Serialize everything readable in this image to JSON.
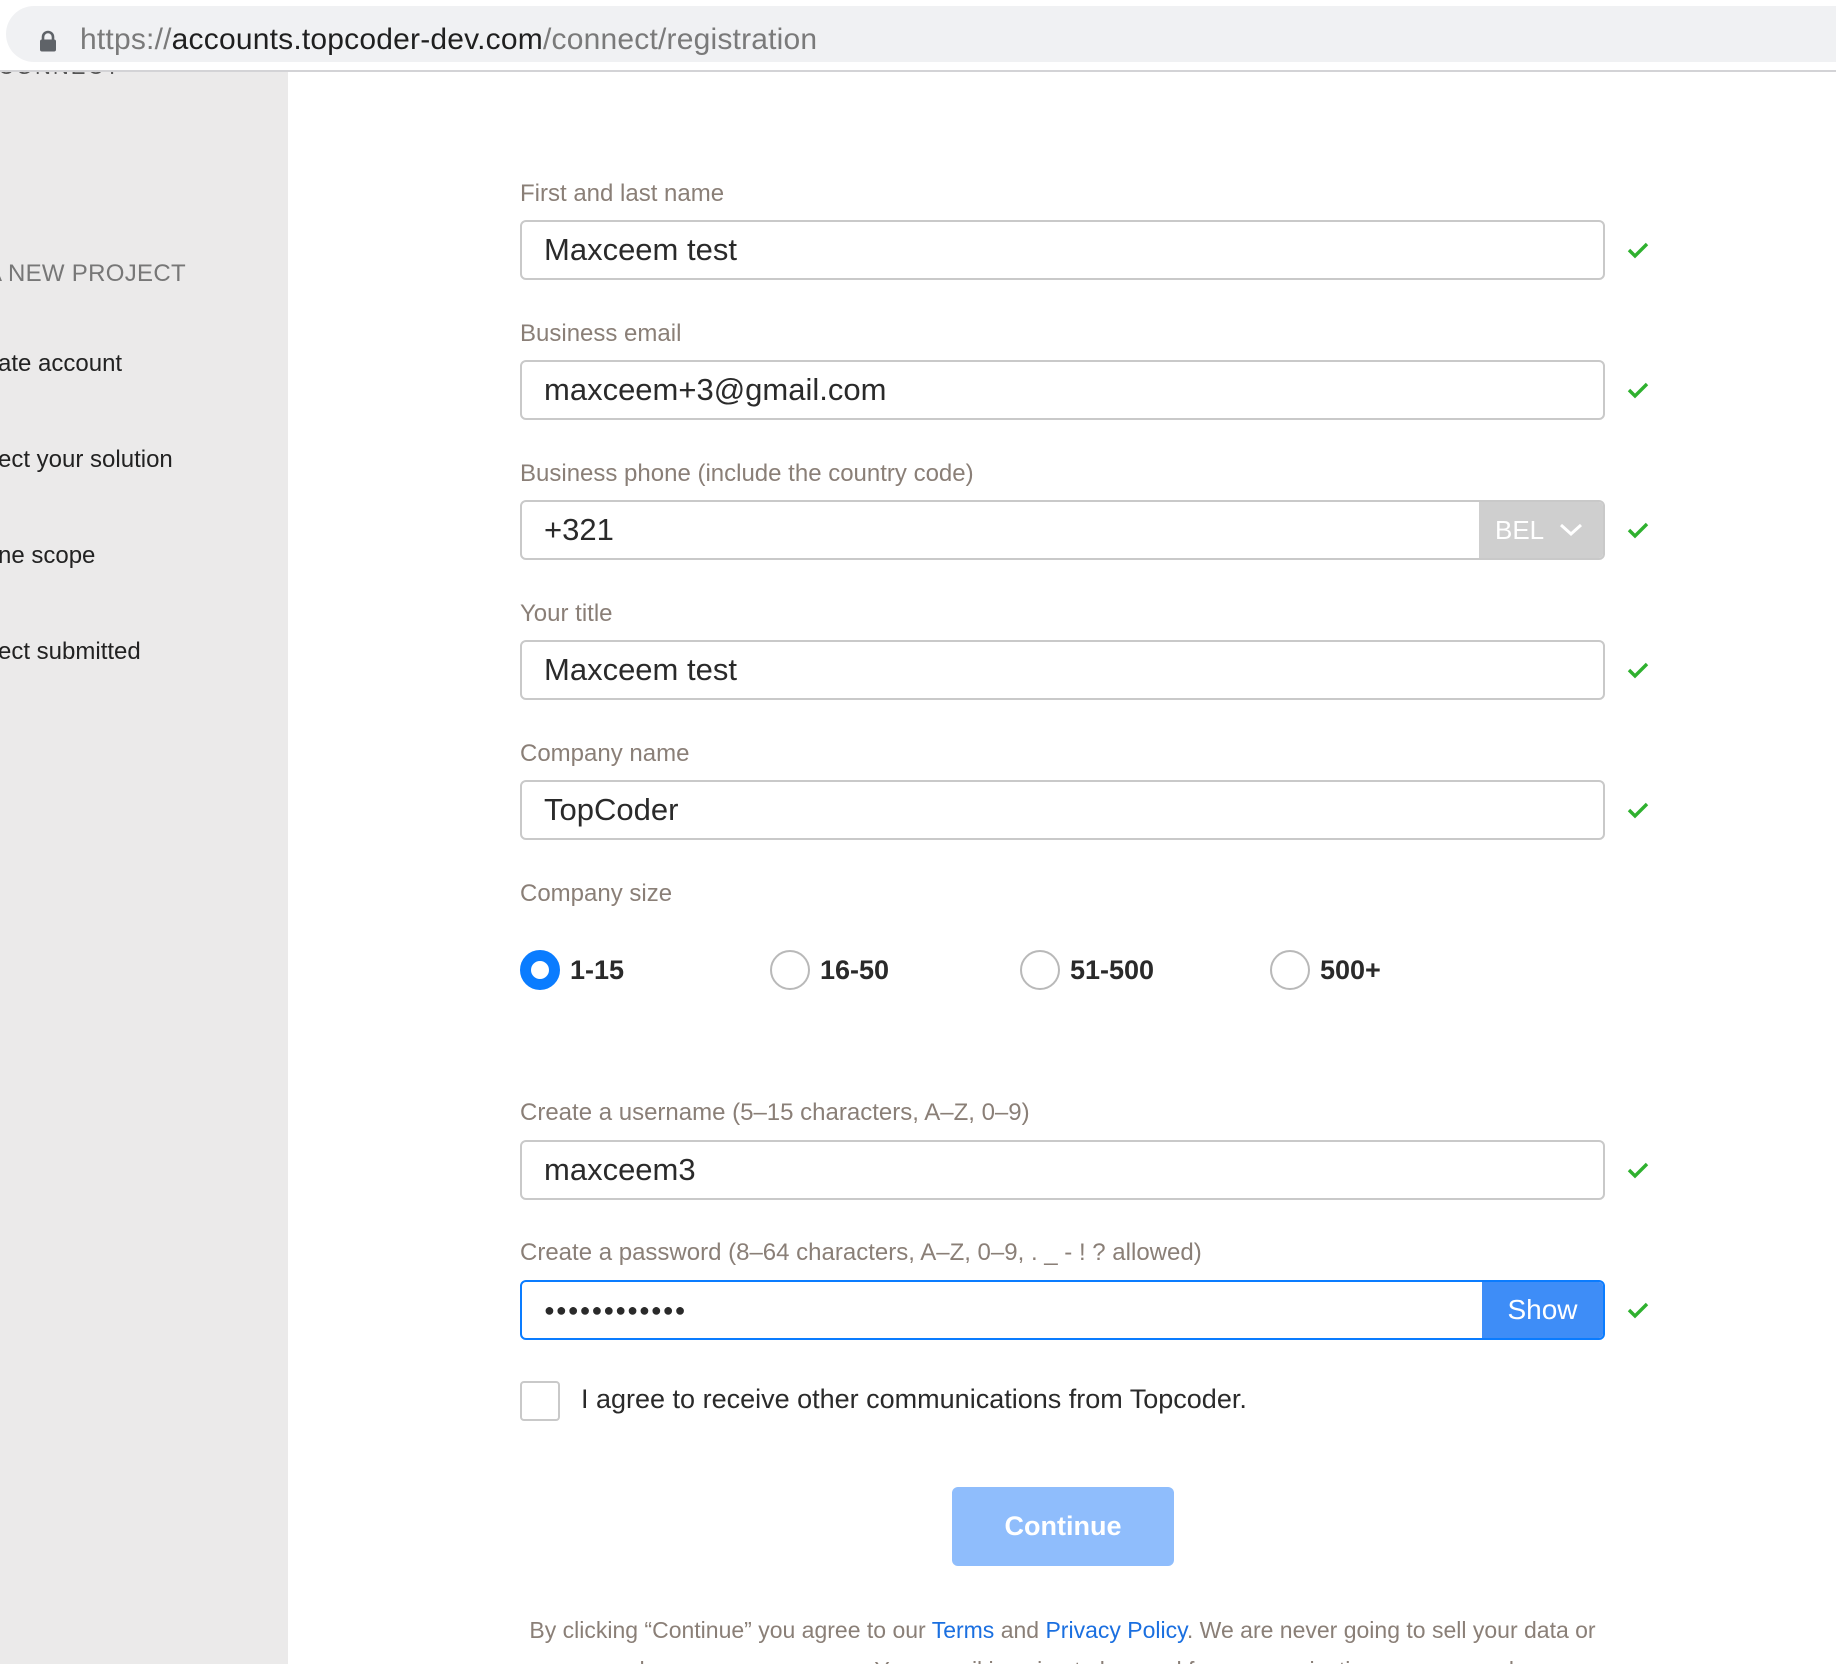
{
  "browser": {
    "url_scheme": "https://",
    "url_host": "accounts.topcoder-dev.com",
    "url_path": "/connect/registration"
  },
  "sidebar": {
    "top_text": "CONNECT",
    "heading": "A NEW PROJECT",
    "steps": [
      "ate account",
      "ect your solution",
      "ne scope",
      "ect submitted"
    ]
  },
  "form": {
    "name": {
      "label": "First and last name",
      "value": "Maxceem test",
      "valid": true
    },
    "email": {
      "label": "Business email",
      "value": "maxceem+3@gmail.com",
      "valid": true
    },
    "phone": {
      "label": "Business phone (include the country code)",
      "value": "+321",
      "country": "BEL",
      "valid": true
    },
    "title": {
      "label": "Your title",
      "value": "Maxceem test",
      "valid": true
    },
    "company": {
      "label": "Company name",
      "value": "TopCoder",
      "valid": true
    },
    "company_size": {
      "label": "Company size",
      "options": [
        "1-15",
        "16-50",
        "51-500",
        "500+"
      ],
      "selected": "1-15"
    },
    "username": {
      "label": "Create a username (5–15 characters, A–Z, 0–9)",
      "value": "maxceem3",
      "valid": true
    },
    "password": {
      "label": "Create a password (8–64 characters, A–Z, 0–9, . _ - ! ? allowed)",
      "value": "●●●●●●●●●●●●",
      "show_label": "Show",
      "valid": true
    },
    "agree": {
      "label": "I agree to receive other communications from Topcoder.",
      "checked": false
    },
    "continue_label": "Continue",
    "legal": {
      "before": "By clicking “Continue” you agree to our ",
      "terms": "Terms",
      "and": " and ",
      "privacy": "Privacy Policy",
      "after": ". We are never going to sell your data or send you spam messages. Your email is going to be used for communication purposes only."
    }
  },
  "colors": {
    "accent": "#0a7cff",
    "check": "#2fb12f",
    "label": "#8a7f77",
    "sidebar_bg": "#ebeaea",
    "continue_disabled": "#8fbdfc"
  }
}
